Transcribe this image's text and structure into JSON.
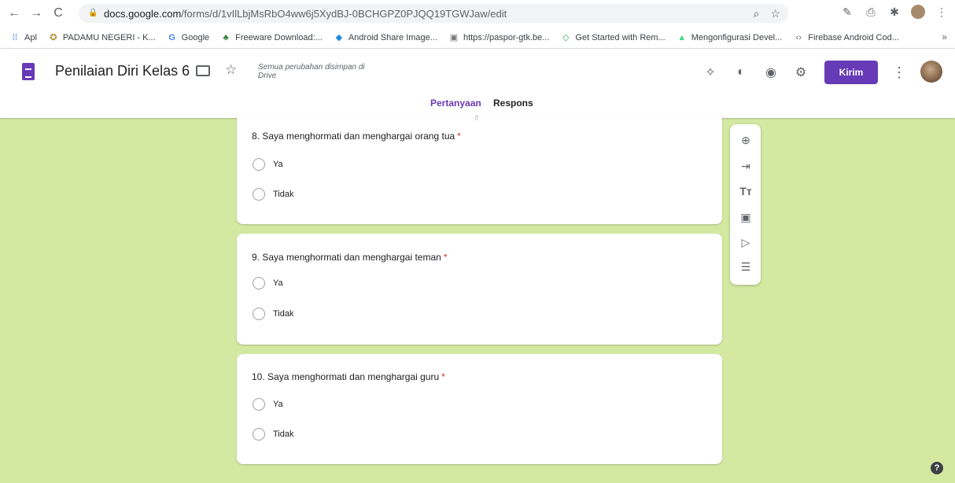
{
  "browser": {
    "url_host": "docs.google.com",
    "url_path": "/forms/d/1vIlLbjMsRbO4ww6j5XydBJ-0BCHGPZ0PJQQ19TGWJaw/edit",
    "bookmarks": [
      {
        "label": "Apl",
        "icon": "apps-grid-icon"
      },
      {
        "label": "PADAMU NEGERI - K...",
        "icon": "emblem-icon"
      },
      {
        "label": "Google",
        "icon": "google-icon"
      },
      {
        "label": "Freeware Download:...",
        "icon": "palm-tree-icon"
      },
      {
        "label": "Android Share Image...",
        "icon": "share-icon"
      },
      {
        "label": "https://paspor-gtk.be...",
        "icon": "site-icon"
      },
      {
        "label": "Get Started with Rem...",
        "icon": "code-icon"
      },
      {
        "label": "Mengonfigurasi Devel...",
        "icon": "android-icon"
      },
      {
        "label": "Firebase Android Cod...",
        "icon": "code-brackets-icon"
      }
    ],
    "more_bookmarks": "»"
  },
  "header": {
    "title": "Penilaian Diri Kelas 6",
    "saved_note": "Semua perubahan disimpan di Drive",
    "send_label": "Kirim"
  },
  "tabs": {
    "questions": "Pertanyaan",
    "responses": "Respons"
  },
  "questions": [
    {
      "title": "8. Saya menghormati dan menghargai orang tua",
      "required": "*",
      "options": [
        "Ya",
        "Tidak"
      ]
    },
    {
      "title": "9. Saya menghormati dan menghargai teman",
      "required": "*",
      "options": [
        "Ya",
        "Tidak"
      ]
    },
    {
      "title": "10. Saya menghormati dan menghargai guru",
      "required": "*",
      "options": [
        "Ya",
        "Tidak"
      ]
    }
  ],
  "colors": {
    "accent": "#673ab7",
    "background": "#d3e9a2",
    "required": "#d93025"
  }
}
